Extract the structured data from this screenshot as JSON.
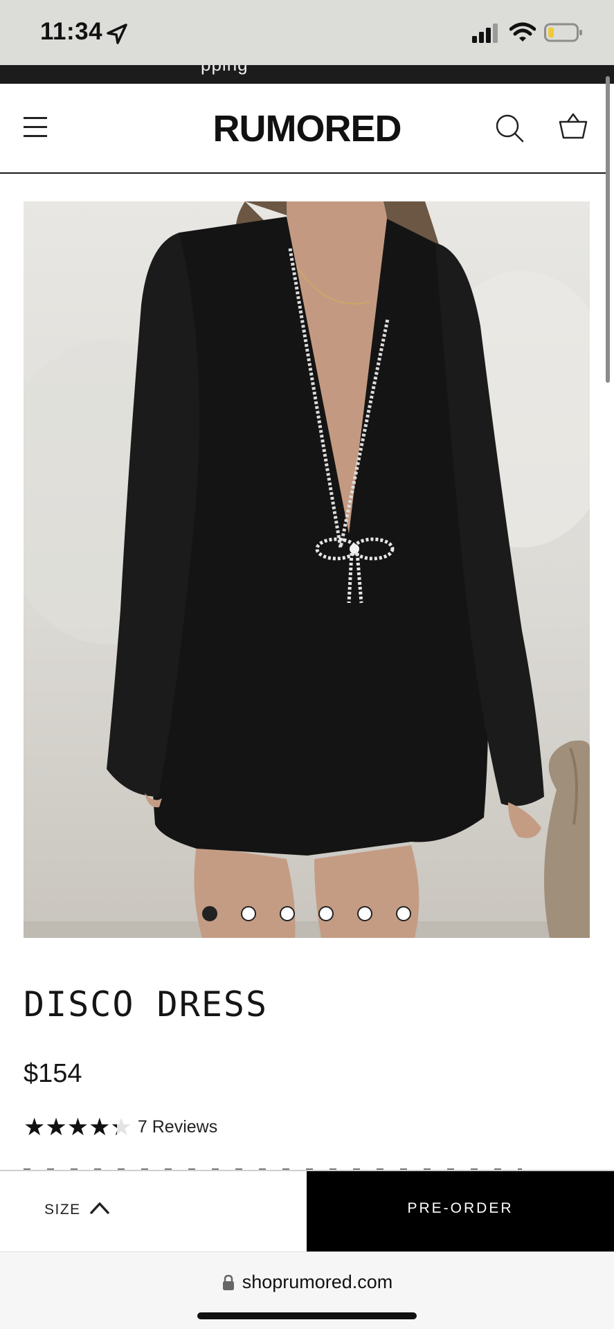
{
  "status_bar": {
    "time": "11:34"
  },
  "announcement": {
    "text": "pping"
  },
  "header": {
    "brand": "RUMORED",
    "menu_icon": "hamburger-icon",
    "search_icon": "search-icon",
    "cart_icon": "basket-icon"
  },
  "product": {
    "image_alt": "black long-sleeve mini dress with crystal bow",
    "carousel_total": 6,
    "carousel_active": 1,
    "title": "DISCO DRESS",
    "price": "$154",
    "rating_stars": 4.3,
    "rating_max": 5,
    "stars_glyphs": "★★★★★",
    "reviews_label": "7 Reviews"
  },
  "sticky_bar": {
    "size_label": "SIZE",
    "preorder_label": "PRE-ORDER"
  },
  "browser": {
    "url": "shoprumored.com"
  },
  "colors": {
    "status_bar_bg": "#dcddd8",
    "announce_bg": "#1c1c1c",
    "primary_button_bg": "#000000",
    "star_color": "#111111",
    "star_empty": "#e3e3e3"
  }
}
